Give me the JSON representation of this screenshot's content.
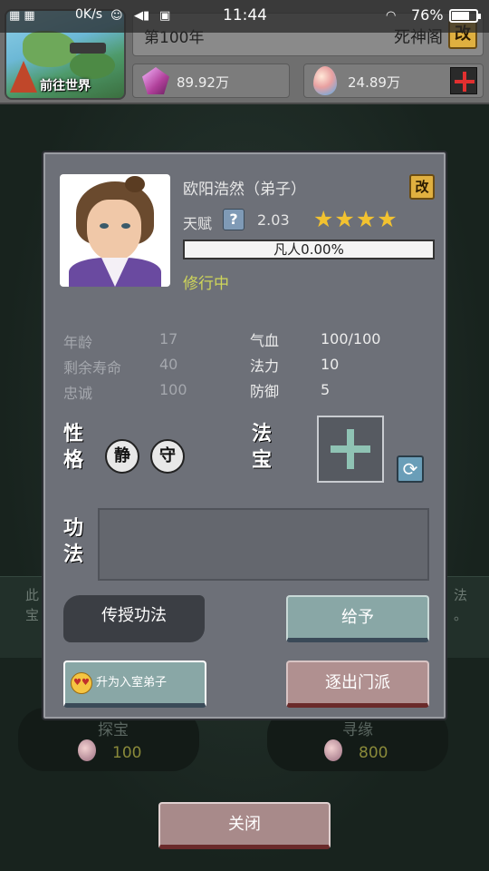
{
  "status_bar": {
    "speed": "0K/s",
    "time": "11:44",
    "battery": "76%",
    "battery_level": 0.76
  },
  "header": {
    "map_label": "前往世界",
    "year": "第100年",
    "sect_name": "死神阁",
    "rename_glyph": "改",
    "resource_spirit_stone": "89.92万",
    "resource_egg": "24.89万"
  },
  "background": {
    "left_text_1": "此",
    "left_text_2": "宝",
    "right_text_1": "法",
    "right_text_2": "。",
    "card_left_label": "探宝",
    "card_left_price": "100",
    "card_right_label": "寻缘",
    "card_right_price": "800"
  },
  "disciple": {
    "name": "欧阳浩然（弟子）",
    "rename_glyph": "改",
    "talent_label": "天赋",
    "help_glyph": "?",
    "talent_value": "2.03",
    "stars": 4,
    "realm_progress_text": "凡人0.00%",
    "realm_progress": 0.0,
    "status": "修行中"
  },
  "attributes": {
    "age_label": "年龄",
    "age_value": "17",
    "lifespan_label": "剩余寿命",
    "lifespan_value": "40",
    "loyalty_label": "忠诚",
    "loyalty_value": "100",
    "hp_label": "气血",
    "hp_value": "100/100",
    "mp_label": "法力",
    "mp_value": "10",
    "def_label": "防御",
    "def_value": "5"
  },
  "sections": {
    "personality_1": "性",
    "personality_2": "格",
    "trait_1": "静",
    "trait_2": "守",
    "treasure_1": "法",
    "treasure_2": "宝",
    "skill_1": "功",
    "skill_2": "法"
  },
  "buttons": {
    "teach": "传授功法",
    "give": "给予",
    "promote": "升为入室弟子",
    "expel": "逐出门派",
    "close": "关闭"
  },
  "colors": {
    "star": "#f2c230",
    "status": "#cfd65a",
    "accent_red": "#e23030"
  }
}
